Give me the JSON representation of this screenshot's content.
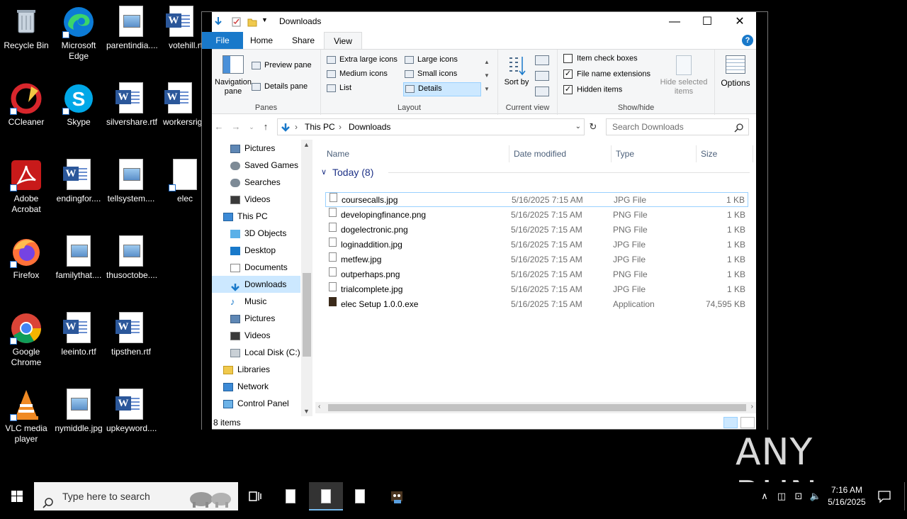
{
  "desktop": {
    "icons": [
      {
        "label": "Recycle Bin"
      },
      {
        "label": "Microsoft Edge"
      },
      {
        "label": "parentindia...."
      },
      {
        "label": "votehill.rtf"
      },
      {
        "label": "CCleaner"
      },
      {
        "label": "Skype"
      },
      {
        "label": "silvershare.rtf"
      },
      {
        "label": "workersright"
      },
      {
        "label": "Adobe Acrobat"
      },
      {
        "label": "endingfor...."
      },
      {
        "label": "tellsystem...."
      },
      {
        "label": "elec"
      },
      {
        "label": "Firefox"
      },
      {
        "label": "familythat...."
      },
      {
        "label": "thusoctobe...."
      },
      {
        "label": "Google Chrome"
      },
      {
        "label": "leeinto.rtf"
      },
      {
        "label": "tipsthen.rtf"
      },
      {
        "label": "VLC media player"
      },
      {
        "label": "nymiddle.jpg"
      },
      {
        "label": "upkeyword...."
      }
    ]
  },
  "window": {
    "title": "Downloads",
    "controls": {
      "minimize": "—",
      "maximize": "☐",
      "close": "✕"
    }
  },
  "ribbon": {
    "tabs": [
      "File",
      "Home",
      "Share",
      "View"
    ],
    "active_tab": "View",
    "panes": {
      "label": "Panes",
      "navigation_pane": "Navigation pane",
      "preview_pane": "Preview pane",
      "details_pane": "Details pane"
    },
    "layout": {
      "label": "Layout",
      "items": [
        "Extra large icons",
        "Large icons",
        "Medium icons",
        "Small icons",
        "List",
        "Details"
      ],
      "selected": "Details"
    },
    "current_view": {
      "label": "Current view",
      "sort_by": "Sort by"
    },
    "show_hide": {
      "label": "Show/hide",
      "item_check_boxes": "Item check boxes",
      "file_name_extensions": "File name extensions",
      "hidden_items": "Hidden items",
      "hide_selected_items": "Hide selected items",
      "checks": {
        "item_check_boxes": false,
        "file_name_extensions": true,
        "hidden_items": true
      }
    },
    "options": "Options"
  },
  "address": {
    "path": [
      "This PC",
      "Downloads"
    ],
    "search_placeholder": "Search Downloads"
  },
  "nav_pane": {
    "items": [
      {
        "label": "Pictures"
      },
      {
        "label": "Saved Games"
      },
      {
        "label": "Searches"
      },
      {
        "label": "Videos"
      },
      {
        "label": "This PC"
      },
      {
        "label": "3D Objects"
      },
      {
        "label": "Desktop"
      },
      {
        "label": "Documents"
      },
      {
        "label": "Downloads"
      },
      {
        "label": "Music"
      },
      {
        "label": "Pictures"
      },
      {
        "label": "Videos"
      },
      {
        "label": "Local Disk (C:)"
      },
      {
        "label": "Libraries"
      },
      {
        "label": "Network"
      },
      {
        "label": "Control Panel"
      }
    ],
    "selected": "Downloads"
  },
  "file_list": {
    "columns": [
      "Name",
      "Date modified",
      "Type",
      "Size"
    ],
    "group_label": "Today (8)",
    "files": [
      {
        "name": "coursecalls.jpg",
        "date": "5/16/2025 7:15 AM",
        "type": "JPG File",
        "size": "1 KB"
      },
      {
        "name": "developingfinance.png",
        "date": "5/16/2025 7:15 AM",
        "type": "PNG File",
        "size": "1 KB"
      },
      {
        "name": "dogelectronic.png",
        "date": "5/16/2025 7:15 AM",
        "type": "PNG File",
        "size": "1 KB"
      },
      {
        "name": "loginaddition.jpg",
        "date": "5/16/2025 7:15 AM",
        "type": "JPG File",
        "size": "1 KB"
      },
      {
        "name": "metfew.jpg",
        "date": "5/16/2025 7:15 AM",
        "type": "JPG File",
        "size": "1 KB"
      },
      {
        "name": "outperhaps.png",
        "date": "5/16/2025 7:15 AM",
        "type": "PNG File",
        "size": "1 KB"
      },
      {
        "name": "trialcomplete.jpg",
        "date": "5/16/2025 7:15 AM",
        "type": "JPG File",
        "size": "1 KB"
      },
      {
        "name": "elec Setup 1.0.0.exe",
        "date": "5/16/2025 7:15 AM",
        "type": "Application",
        "size": "74,595 KB"
      }
    ]
  },
  "status": {
    "item_count": "8 items"
  },
  "taskbar": {
    "search_placeholder": "Type here to search",
    "time": "7:16 AM",
    "date": "5/16/2025"
  },
  "watermark": "ANY RUN"
}
